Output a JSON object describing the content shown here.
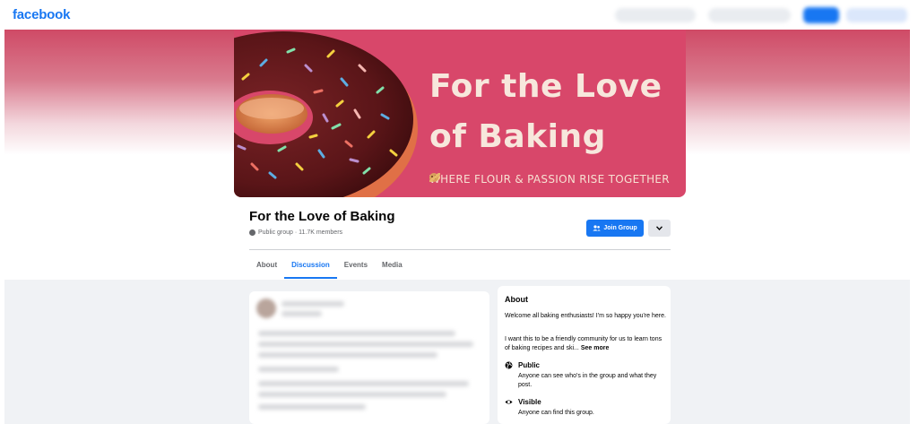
{
  "nav": {
    "logo": "facebook"
  },
  "cover": {
    "title_line1": "For the Love",
    "title_line2": "of Baking",
    "tagline": "WHERE FLOUR & PASSION RISE TOGETHER"
  },
  "group": {
    "name": "For the Love of Baking",
    "meta": "Public group · 11.7K members",
    "join_label": "Join Group"
  },
  "tabs": [
    {
      "label": "About"
    },
    {
      "label": "Discussion"
    },
    {
      "label": "Events"
    },
    {
      "label": "Media"
    }
  ],
  "about": {
    "title": "About",
    "intro": "Welcome all baking enthusiasts! I'm so happy you're here.",
    "desc": "I want this to be a friendly community for us to learn tons of baking recipes and ski...",
    "see_more": "See more",
    "public_title": "Public",
    "public_desc": "Anyone can see who's in the group and what they post.",
    "visible_title": "Visible",
    "visible_desc": "Anyone can find this group."
  },
  "colors": {
    "brand": "#1877f2",
    "cover_pink": "#d8476a"
  }
}
